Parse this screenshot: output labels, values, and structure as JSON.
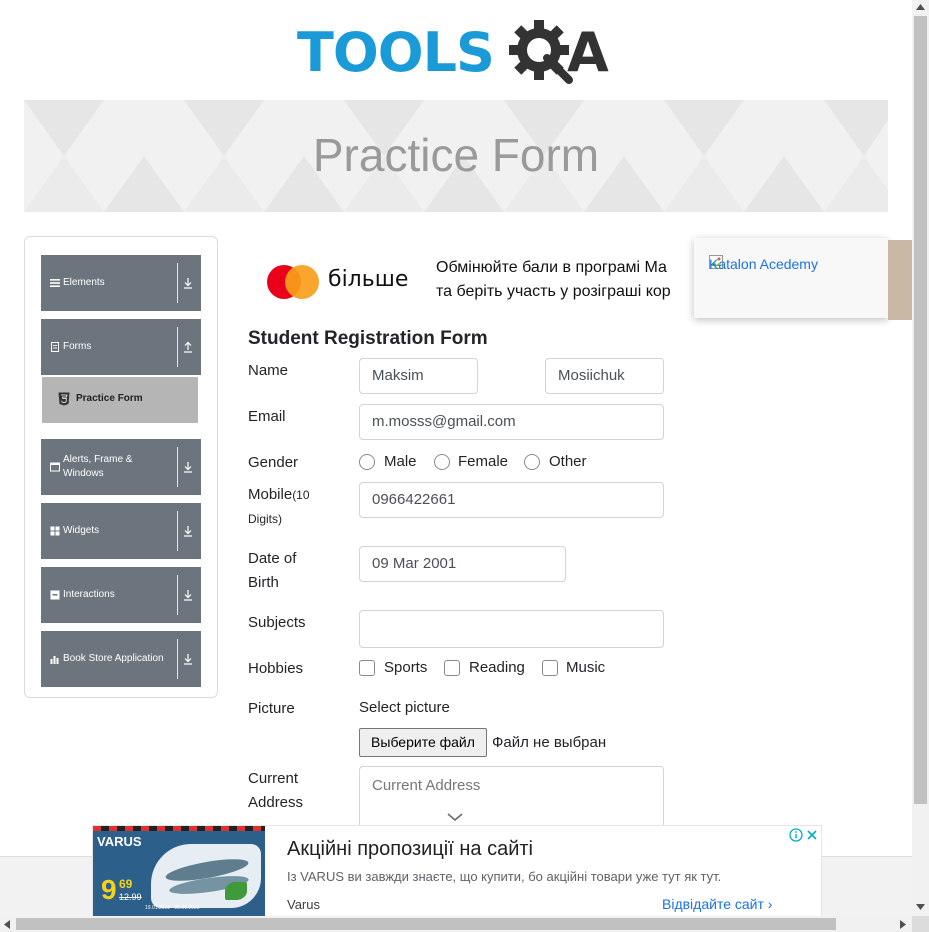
{
  "logo": {
    "part1": "TOOLS",
    "part2": "QA"
  },
  "banner": {
    "title": "Practice Form"
  },
  "sidebar": {
    "groups": [
      {
        "label": "Elements",
        "icon": "hamburger-icon"
      },
      {
        "label": "Forms",
        "icon": "document-icon"
      },
      {
        "label": "Alerts, Frame & Windows",
        "icon": "window-icon"
      },
      {
        "label": "Widgets",
        "icon": "grid-icon"
      },
      {
        "label": "Interactions",
        "icon": "box-icon"
      },
      {
        "label": "Book Store Application",
        "icon": "chart-icon"
      }
    ],
    "active_item": "Practice Form"
  },
  "ad_top": {
    "brand": "більше",
    "line1": "Обмінюйте бали в програмі Ма",
    "line2": "та беріть участь у розіграші кор"
  },
  "katalon": {
    "alt": "Katalon Acedemy"
  },
  "form": {
    "title": "Student Registration Form",
    "labels": {
      "name": "Name",
      "email": "Email",
      "gender": "Gender",
      "mobile": "Mobile",
      "mobile_hint": "(10",
      "mobile_hint2": "Digits)",
      "dob1": "Date of",
      "dob2": "Birth",
      "subjects": "Subjects",
      "hobbies": "Hobbies",
      "picture": "Picture",
      "address1": "Current",
      "address2": "Address"
    },
    "first_name": "Maksim",
    "last_name": "Mosiichuk",
    "email": "m.mosss@gmail.com",
    "gender_options": [
      "Male",
      "Female",
      "Other"
    ],
    "mobile": "0966422661",
    "dob": "09 Mar 2001",
    "subjects": "",
    "hobby_options": [
      "Sports",
      "Reading",
      "Music"
    ],
    "picture_prompt": "Select picture",
    "file_button": "Выберите файл",
    "file_status": "Файл не выбран",
    "address_placeholder": "Current Address"
  },
  "ad_bottom": {
    "title": "Акційні пропозиції на сайті",
    "description": "Із VARUS ви завжди знаєте, що купити, бо акційні товари уже тут як тут.",
    "advertiser": "Varus",
    "cta": "Відвідайте сайт",
    "image_brand": "VARUS",
    "image_price": "9",
    "image_cents": "69",
    "image_old_price": "12.99",
    "image_dates": "19.01.2023 - 25.01.2023"
  },
  "colors": {
    "tools_blue": "#1a9bd7",
    "qa_dark": "#333333",
    "menu_gray": "#6c757d",
    "link_blue": "#1a73e8"
  }
}
